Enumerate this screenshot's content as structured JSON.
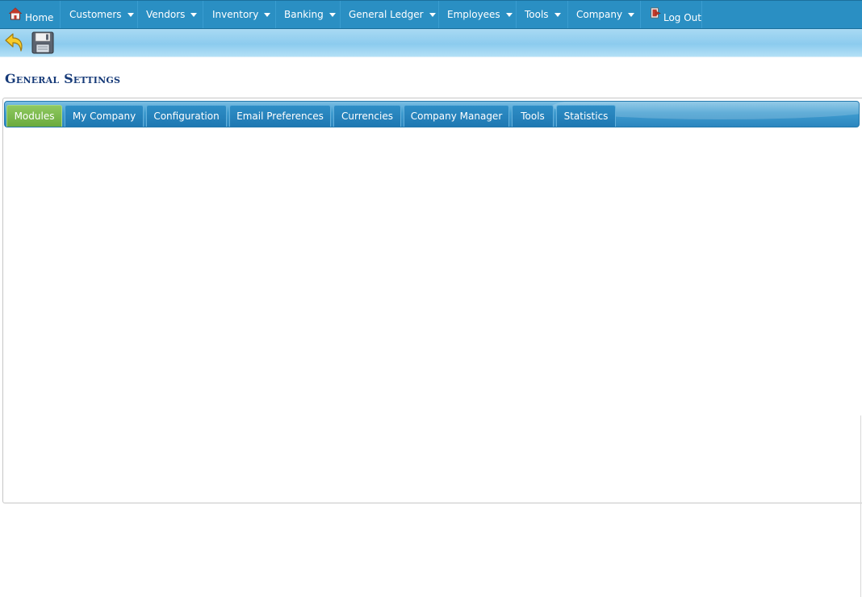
{
  "nav": {
    "home": "Home",
    "items": [
      {
        "label": "Customers"
      },
      {
        "label": "Vendors"
      },
      {
        "label": "Inventory"
      },
      {
        "label": "Banking"
      },
      {
        "label": "General Ledger"
      },
      {
        "label": "Employees"
      },
      {
        "label": "Tools"
      },
      {
        "label": "Company"
      }
    ],
    "logout": "Log Out"
  },
  "toolbar": {
    "buttons": [
      {
        "icon": "back-arrow-icon"
      },
      {
        "icon": "save-disk-icon"
      }
    ]
  },
  "page": {
    "title": "General Settings"
  },
  "tabs": [
    {
      "label": "Modules",
      "active": true
    },
    {
      "label": "My Company"
    },
    {
      "label": "Configuration"
    },
    {
      "label": "Email Preferences"
    },
    {
      "label": "Currencies"
    },
    {
      "label": "Company Manager"
    },
    {
      "label": "Tools"
    },
    {
      "label": "Statistics"
    }
  ],
  "colors": {
    "nav_bg": "#2a8fc3",
    "toolbar_bg": "#8ccbee",
    "title": "#163a78",
    "tab_active": "#7ab84c",
    "tab_inactive": "#2580ba"
  }
}
